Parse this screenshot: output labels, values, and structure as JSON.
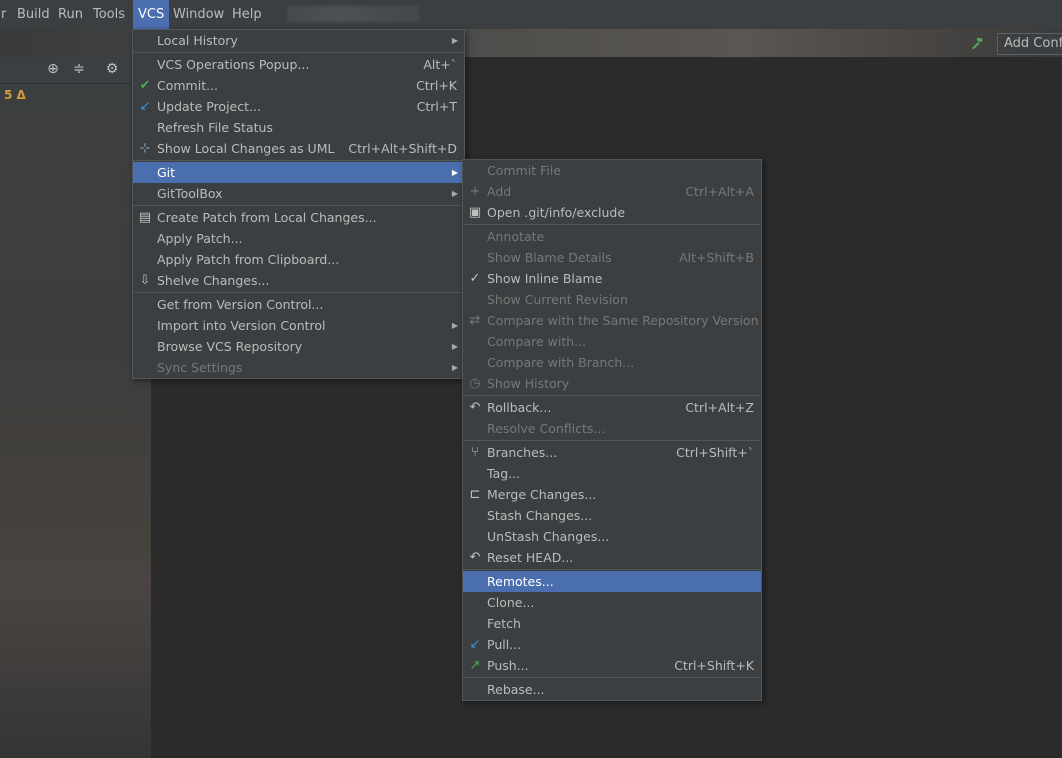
{
  "menubar": {
    "items": [
      {
        "label": "r"
      },
      {
        "label": "Build"
      },
      {
        "label": "Run"
      },
      {
        "label": "Tools"
      },
      {
        "label": "VCS"
      },
      {
        "label": "Window"
      },
      {
        "label": "Help"
      }
    ]
  },
  "toolbar": {
    "add_config_label": "Add Confi"
  },
  "left_panel": {
    "change_count": "5 Δ"
  },
  "vcs_menu": {
    "items": [
      {
        "label": "Local History"
      },
      {
        "label": "VCS Operations Popup...",
        "shortcut": "Alt+`"
      },
      {
        "label": "Commit...",
        "shortcut": "Ctrl+K"
      },
      {
        "label": "Update Project...",
        "shortcut": "Ctrl+T"
      },
      {
        "label": "Refresh File Status"
      },
      {
        "label": "Show Local Changes as UML",
        "shortcut": "Ctrl+Alt+Shift+D"
      },
      {
        "label": "Git"
      },
      {
        "label": "GitToolBox"
      },
      {
        "label": "Create Patch from Local Changes..."
      },
      {
        "label": "Apply Patch..."
      },
      {
        "label": "Apply Patch from Clipboard..."
      },
      {
        "label": "Shelve Changes..."
      },
      {
        "label": "Get from Version Control..."
      },
      {
        "label": "Import into Version Control"
      },
      {
        "label": "Browse VCS Repository"
      },
      {
        "label": "Sync Settings"
      }
    ]
  },
  "git_menu": {
    "items": [
      {
        "label": "Commit File"
      },
      {
        "label": "Add",
        "shortcut": "Ctrl+Alt+A"
      },
      {
        "label": "Open .git/info/exclude"
      },
      {
        "label": "Annotate"
      },
      {
        "label": "Show Blame Details",
        "shortcut": "Alt+Shift+B"
      },
      {
        "label": "Show Inline Blame"
      },
      {
        "label": "Show Current Revision"
      },
      {
        "label": "Compare with the Same Repository Version"
      },
      {
        "label": "Compare with..."
      },
      {
        "label": "Compare with Branch..."
      },
      {
        "label": "Show History"
      },
      {
        "label": "Rollback...",
        "shortcut": "Ctrl+Alt+Z"
      },
      {
        "label": "Resolve Conflicts..."
      },
      {
        "label": "Branches...",
        "shortcut": "Ctrl+Shift+`"
      },
      {
        "label": "Tag..."
      },
      {
        "label": "Merge Changes..."
      },
      {
        "label": "Stash Changes..."
      },
      {
        "label": "UnStash Changes..."
      },
      {
        "label": "Reset HEAD..."
      },
      {
        "label": "Remotes..."
      },
      {
        "label": "Clone..."
      },
      {
        "label": "Fetch"
      },
      {
        "label": "Pull..."
      },
      {
        "label": "Push...",
        "shortcut": "Ctrl+Shift+K"
      },
      {
        "label": "Rebase..."
      }
    ]
  },
  "colors": {
    "menu_bg": "#3c3f41",
    "selection": "#4b6eaf",
    "text": "#bbbbbb",
    "disabled_text": "#777777",
    "check_green": "#4fa85a",
    "update_blue": "#3d8fd6"
  }
}
